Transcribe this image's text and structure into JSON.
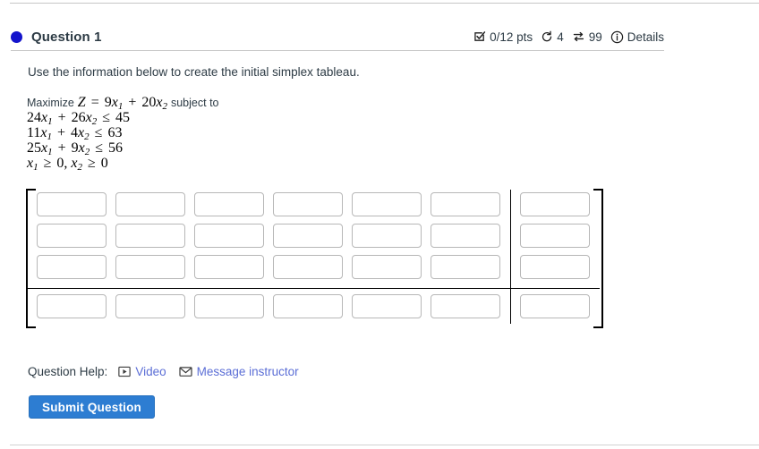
{
  "page": {
    "top_rule": true,
    "bottom_rule": true
  },
  "question": {
    "status_dot_color": "#1414cc",
    "title": "Question 1",
    "meta": {
      "score_icon": "checkbox-checked-icon",
      "score": "0/12 pts",
      "attempts_icon": "undo-arrow-icon",
      "attempts": "4",
      "regenerate_icon": "swap-arrows-icon",
      "regenerate": "99",
      "details_icon": "info-circle-icon",
      "details_label": "Details"
    }
  },
  "body": {
    "prompt": "Use the information below to create the initial simplex tableau.",
    "math": {
      "objective_prefix": "Maximize",
      "objective_var": "Z",
      "objective_eq": "=",
      "objective_c1": "9",
      "objective_x1": "x",
      "objective_x1_sub": "1",
      "objective_plus": "+",
      "objective_c2": "20",
      "objective_x2": "x",
      "objective_x2_sub": "2",
      "objective_suffix": "subject to",
      "constraints": [
        {
          "a": "24",
          "x1": "x",
          "s1": "1",
          "op1": "+",
          "b": "26",
          "x2": "x",
          "s2": "2",
          "rel": "≤",
          "rhs": "45"
        },
        {
          "a": "11",
          "x1": "x",
          "s1": "1",
          "op1": "+",
          "b": "4",
          "x2": "x",
          "s2": "2",
          "rel": "≤",
          "rhs": "63"
        },
        {
          "a": "25",
          "x1": "x",
          "s1": "1",
          "op1": "+",
          "b": "9",
          "x2": "x",
          "s2": "2",
          "rel": "≤",
          "rhs": "56"
        }
      ],
      "nonneg": {
        "x1": "x",
        "x1_sub": "1",
        "rel1": "≥",
        "zero1": "0",
        "comma": ",",
        "x2": "x",
        "x2_sub": "2",
        "rel2": "≥",
        "zero2": "0"
      }
    }
  },
  "tableau": {
    "rows": 4,
    "cols": 7,
    "vertical_divider_after_col": 6,
    "horizontal_divider_after_row": 3,
    "cell_values": [
      [
        "",
        "",
        "",
        "",
        "",
        "",
        ""
      ],
      [
        "",
        "",
        "",
        "",
        "",
        "",
        ""
      ],
      [
        "",
        "",
        "",
        "",
        "",
        "",
        ""
      ],
      [
        "",
        "",
        "",
        "",
        "",
        "",
        ""
      ]
    ],
    "cell_placeholder": ""
  },
  "footer": {
    "help_label": "Question Help:",
    "video_icon": "video-play-icon",
    "video_label": "Video",
    "message_icon": "envelope-icon",
    "message_label": "Message instructor",
    "submit_label": "Submit Question",
    "submit_color": "#2d7dd2",
    "link_color": "#5b6ed6"
  }
}
